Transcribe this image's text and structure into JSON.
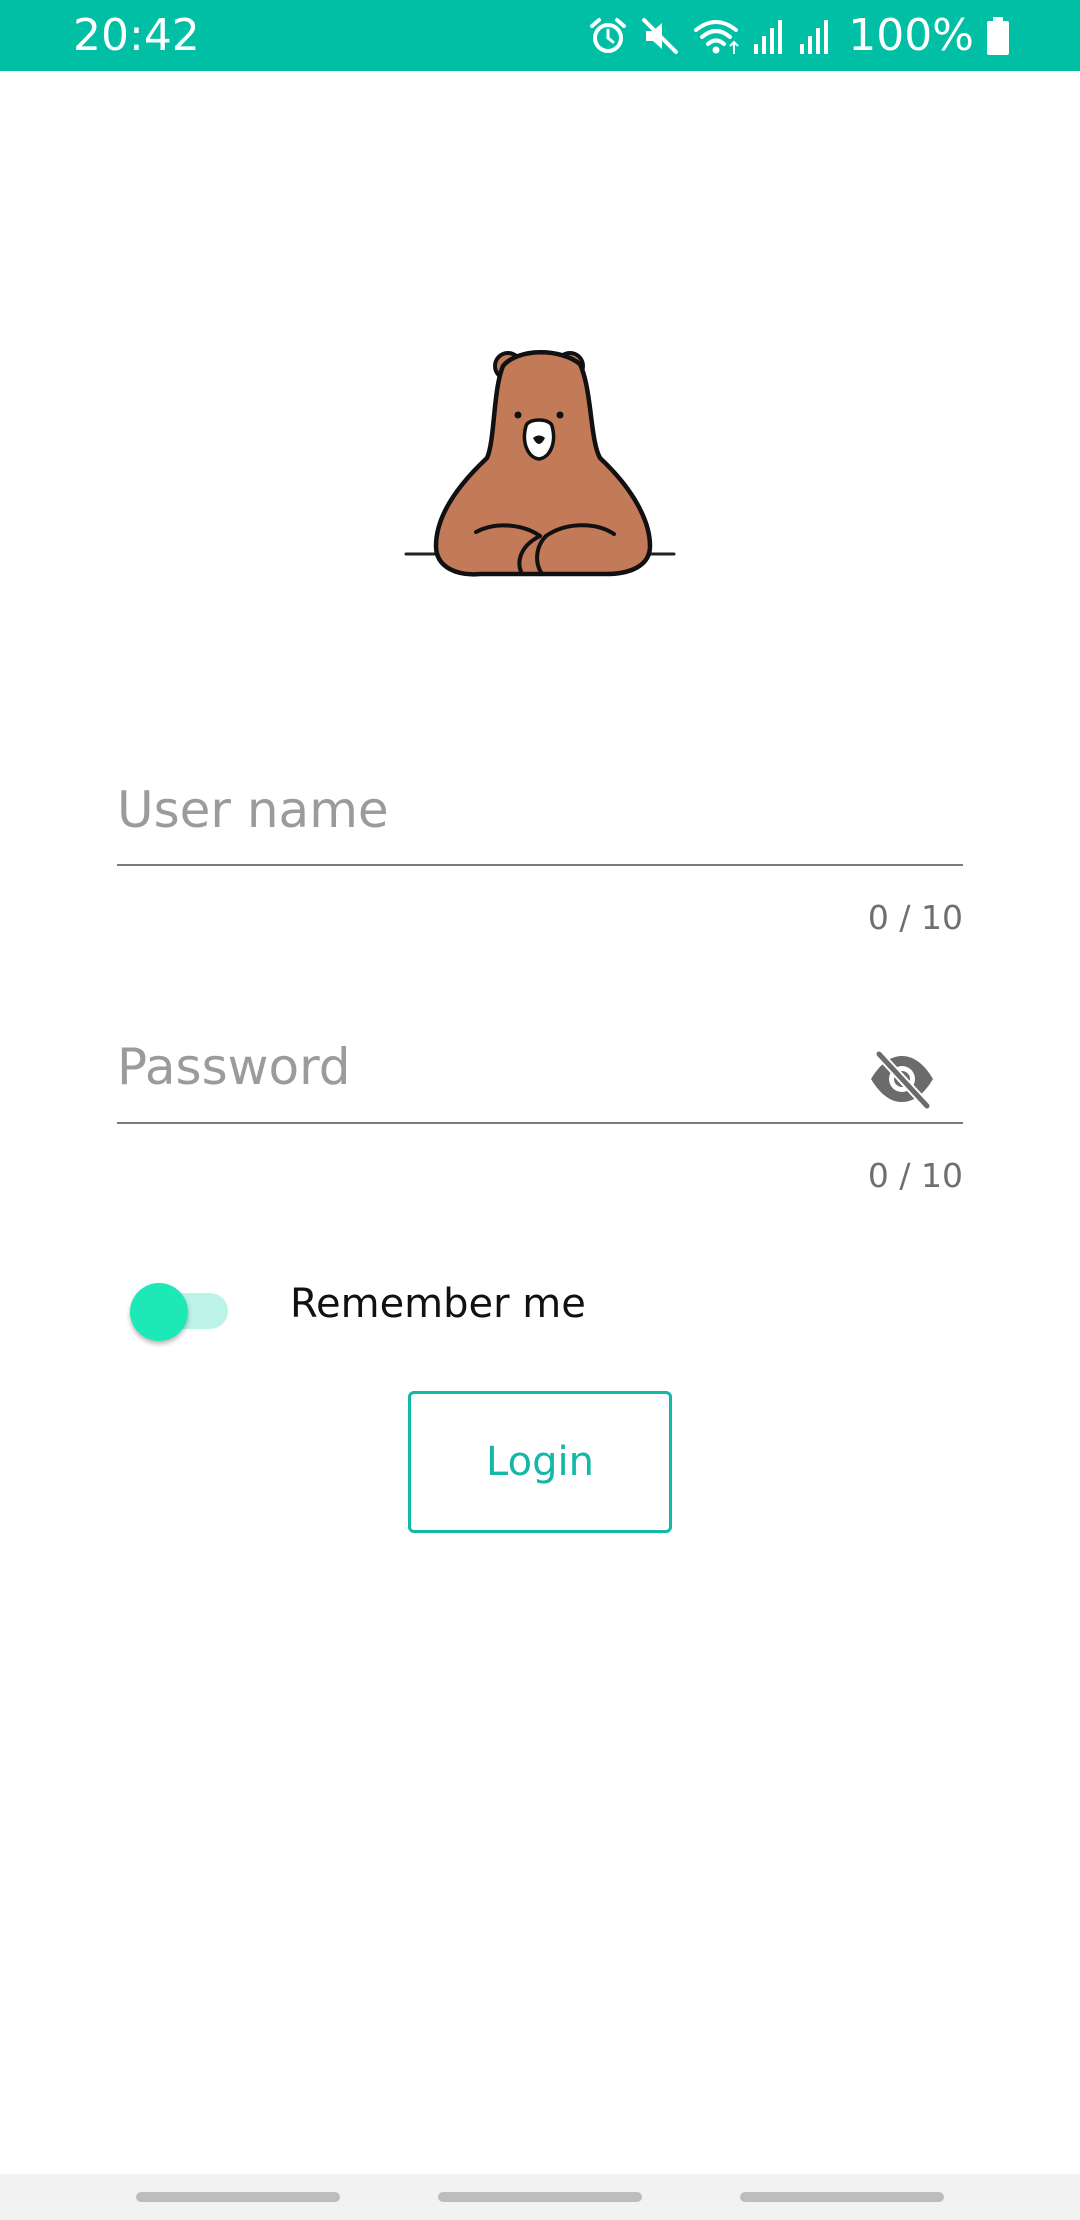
{
  "status_bar": {
    "time": "20:42",
    "battery_level": "100%",
    "icons": [
      "alarm-icon",
      "mute-icon",
      "wifi-icon",
      "signal-icon",
      "signal-icon",
      "battery-icon"
    ],
    "background_color": "#00bfa5"
  },
  "logo": {
    "icon": "bear-icon"
  },
  "form": {
    "username": {
      "placeholder": "User name",
      "value": "",
      "counter": "0 / 10"
    },
    "password": {
      "placeholder": "Password",
      "value": "",
      "counter": "0 / 10",
      "toggle_icon": "visibility-off-icon"
    },
    "remember_me": {
      "label": "Remember me",
      "checked": true
    },
    "login_button_label": "Login"
  },
  "colors": {
    "accent": "#14b8a6",
    "switch_thumb": "#1de9b6",
    "switch_track": "#bdf3e6",
    "bear_fur": "#c27a59"
  }
}
